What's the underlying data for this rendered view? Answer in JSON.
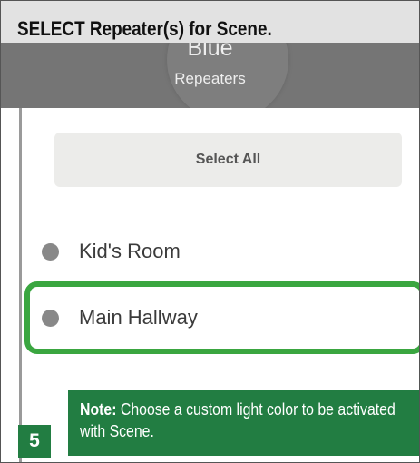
{
  "instruction": {
    "title": "SELECT Repeater(s) for Scene."
  },
  "header": {
    "group_name": "Blue",
    "section_label": "Repeaters"
  },
  "select_all": {
    "label": "Select All"
  },
  "repeaters": [
    {
      "label": "Kid's Room",
      "highlighted": false
    },
    {
      "label": "Main Hallway",
      "highlighted": true
    }
  ],
  "note": {
    "label": "Note:",
    "text": "Choose a custom light color to be activated with Scene."
  },
  "step": {
    "number": "5"
  },
  "colors": {
    "header_bg": "#757575",
    "highlight_green": "#3aa640",
    "note_green": "#227d42",
    "title_bar_bg": "#e2e2e2"
  },
  "icons": {
    "repeater_bullet": "circle-dot-icon"
  }
}
